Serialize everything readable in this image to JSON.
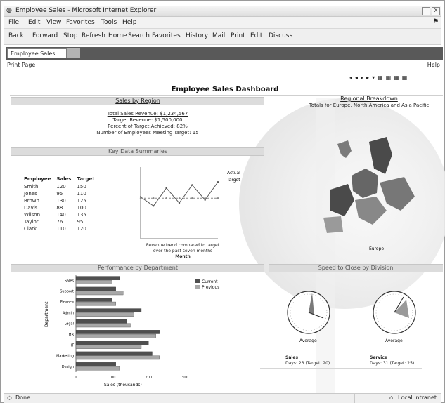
{
  "window": {
    "title": "Employee Sales - Microsoft Internet Explorer",
    "minimize": "_",
    "close": "X"
  },
  "menubar": {
    "items": [
      "File",
      "Edit",
      "View",
      "Favorites",
      "Tools",
      "Help"
    ]
  },
  "toolbar": {
    "items": [
      "Back",
      "Forward",
      "Stop",
      "Refresh",
      "Home",
      "Search",
      "Favorites",
      "History",
      "Mail",
      "Print",
      "Edit",
      "Discuss"
    ]
  },
  "tab": {
    "label": "Employee Sales"
  },
  "subbar": {
    "left": "Print Page",
    "right": "Help"
  },
  "controls": {
    "glyphs": [
      "◂",
      "◂",
      "▸",
      "▸",
      "▾",
      "▦",
      "▦",
      "▦",
      "▦"
    ]
  },
  "dashboard": {
    "title": "Employee Sales Dashboard",
    "top_left_header": "Sales by Region",
    "top_right_header": "Regional Breakdown",
    "top_right_caption": "Totals for Europe, North America and Asia Pacific",
    "summary_lines": [
      "Total Sales Revenue: $1,234,567",
      "Target Revenue: $1,500,000",
      "Percent of Target Achieved: 82%",
      "Number of Employees Meeting Target: 15"
    ],
    "key_data_header": "Key Data Summaries",
    "table": {
      "headers": [
        "Employee",
        "Sales",
        "Target"
      ],
      "rows": [
        [
          "Smith",
          "120",
          "150"
        ],
        [
          "Jones",
          "95",
          "110"
        ],
        [
          "Brown",
          "130",
          "125"
        ],
        [
          "Davis",
          "88",
          "100"
        ],
        [
          "Wilson",
          "140",
          "135"
        ],
        [
          "Taylor",
          "76",
          "95"
        ],
        [
          "Clark",
          "110",
          "120"
        ]
      ]
    },
    "line_chart_caption_1": "Revenue trend compared to target",
    "line_chart_caption_2": "over the past seven months",
    "line_chart_xlabel": "Month",
    "line_legend": [
      "Actual",
      "Target"
    ],
    "map_label": "Europe",
    "bar_header": "Performance by Department",
    "bar_legend": [
      "Current",
      "Previous"
    ],
    "bar_xlabel": "Sales (thousands)",
    "bar_ylabel": "Department",
    "bar_ticks": [
      "0",
      "100",
      "200",
      "300"
    ],
    "gauge_header": "Speed to Close by Division",
    "gauge_left_label": "Average",
    "gauge_left_caption_1": "Sales",
    "gauge_left_caption_2": "Days: 23 (Target: 20)",
    "gauge_right_label": "Average",
    "gauge_right_caption_1": "Service",
    "gauge_right_caption_2": "Days: 31 (Target: 25)"
  },
  "status": {
    "left": "Done",
    "right": "Local intranet"
  },
  "chart_data": [
    {
      "type": "line",
      "x": [
        1,
        2,
        3,
        4,
        5,
        6,
        7
      ],
      "series": [
        {
          "name": "Actual",
          "values": [
            70,
            55,
            85,
            60,
            90,
            65,
            95
          ]
        },
        {
          "name": "Target",
          "values": [
            68,
            68,
            68,
            68,
            68,
            68,
            68
          ]
        }
      ],
      "xlabel": "Month",
      "ylim": [
        0,
        120
      ],
      "grid": false,
      "legend": "right"
    },
    {
      "type": "bar",
      "orientation": "horizontal",
      "categories": [
        "Sales",
        "Support",
        "Finance",
        "Admin",
        "Legal",
        "HR",
        "IT",
        "Marketing",
        "Design"
      ],
      "series": [
        {
          "name": "Current",
          "values": [
            120,
            110,
            100,
            180,
            140,
            230,
            200,
            210,
            110
          ]
        },
        {
          "name": "Previous",
          "values": [
            100,
            130,
            110,
            160,
            150,
            220,
            180,
            230,
            120
          ]
        }
      ],
      "xlabel": "Sales (thousands)",
      "ylabel": "Department",
      "xlim": [
        0,
        300
      ],
      "legend": "top-right"
    }
  ]
}
